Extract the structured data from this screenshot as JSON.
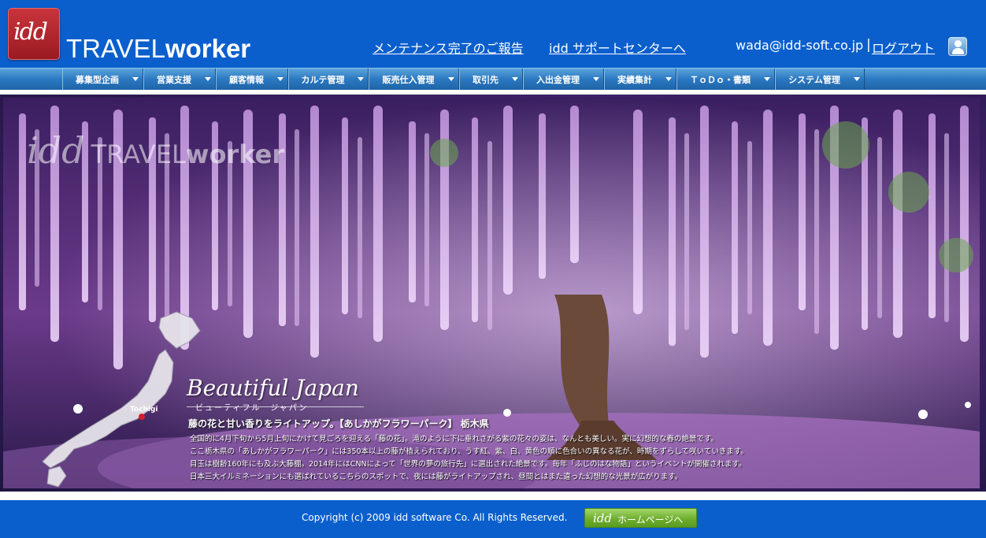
{
  "header": {
    "logo_mark": "idd",
    "brand_part1": "TRAVEL",
    "brand_part2": "worker",
    "links": {
      "maintenance": "メンテナンス完了のご報告",
      "support": "idd サポートセンターへ"
    },
    "user_email": "wada@idd-soft.co.jp",
    "separator": "|",
    "logout": "ログアウト",
    "user_icon": "user-icon"
  },
  "nav": {
    "items": [
      {
        "label": "募集型企画"
      },
      {
        "label": "営業支援"
      },
      {
        "label": "顧客情報"
      },
      {
        "label": "カルテ管理"
      },
      {
        "label": "販売仕入管理"
      },
      {
        "label": "取引先"
      },
      {
        "label": "入出金管理"
      },
      {
        "label": "実績集計"
      },
      {
        "label": "ＴｏＤｏ・書類"
      },
      {
        "label": "システム管理"
      }
    ]
  },
  "hero": {
    "watermark_mark": "idd",
    "watermark_part1": "TRAVEL",
    "watermark_part2": "worker",
    "heading": "Beautiful Japan",
    "heading_kana": "ビューティフル　ジャパン",
    "map_label": "Tochigi",
    "caption_title": "藤の花と甘い香りをライトアップ。【あしかがフラワーパーク】 栃木県",
    "caption_lines": [
      "全国的に4月下旬から5月上旬にかけて見ごろを迎える「藤の花」。滝のように下に垂れさがる紫の花々の姿は、なんとも美しい。実に幻想的な春の絶景です。",
      "ここ栃木県の「あしかがフラワーパーク」には350本以上の藤が植えられており、うす紅、紫、白、黄色の順に色合いの異なる花が、時期をずらして咲いていきます。",
      "目玉は樹齢160年にも及ぶ大藤棚。2014年にはCNNによって「世界の夢の旅行先」に選出された絶景です。毎年「ふじのはな物語」というイベントが開催されます。",
      "日本三大イルミネーションにも選ばれているこちらのスポットで、夜には藤がライトアップされ、昼間とはまた違った幻想的な光景が広がります。"
    ]
  },
  "footer": {
    "copyright": "Copyright (c) 2009 idd software Co. All Rights Reserved.",
    "homepage_mark": "idd",
    "homepage_label": "ホームページへ"
  },
  "colors": {
    "header_blue": "#0a5fcd",
    "nav_blue": "#2b79c1",
    "logo_red": "#b3262d",
    "button_green": "#6fae2f",
    "wisteria_purple": "#b67ad6"
  }
}
